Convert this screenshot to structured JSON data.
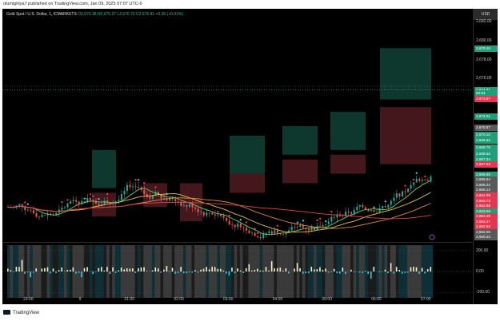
{
  "header": {
    "published_by": "olumightya7 published on TradingView.com, Jan 09, 2025 07:07 UTC-6"
  },
  "legend": {
    "symbol": "Gold Spot / U.S. Dollar, 1, ICMARKETS",
    "ohlc": "O2,676.18  H2,675.27  L2,676.73  C2,676.81  +0.36 (+0.01%)"
  },
  "axis": {
    "currency": "USD",
    "ticks": [
      {
        "label": "2,682.00",
        "v": 2682
      },
      {
        "label": "2,680.00",
        "v": 2680
      },
      {
        "label": "2,678.00",
        "v": 2678
      },
      {
        "label": "2,676.00",
        "v": 2676
      }
    ],
    "tags": [
      {
        "label": "2,679.10",
        "v": 2679.1,
        "color": "#1f9e7a"
      },
      {
        "label": "2,674.81",
        "v": 2674.81,
        "color": "#1f9e7a"
      },
      {
        "label": "00:53",
        "v": 2674.45,
        "color": "#1f9e7a"
      },
      {
        "label": "2,673.87",
        "v": 2673.87,
        "color": "#e2384f"
      },
      {
        "label": "2,672.01",
        "v": 2672.01,
        "color": "#1f9e7a"
      },
      {
        "label": "2,670.87",
        "v": 2670.87,
        "color": "#5a5a5a"
      },
      {
        "label": "2,670.10",
        "v": 2670.1,
        "color": "#1f9e7a"
      },
      {
        "label": "2,669.52",
        "v": 2669.52,
        "color": "#1f9e7a"
      },
      {
        "label": "2,668.76",
        "v": 2668.76,
        "color": "#1f9e7a"
      },
      {
        "label": "2,668.56",
        "v": 2668.1,
        "color": "#1f9e7a"
      },
      {
        "label": "2,667.34",
        "v": 2667.5,
        "color": "#1f9e7a"
      },
      {
        "label": "2,667.03",
        "v": 2666.95,
        "color": "#e2384f"
      },
      {
        "label": "2,665.85",
        "v": 2665.9,
        "color": "#1f9e7a"
      },
      {
        "label": "2,665.64",
        "v": 2665.35,
        "color": "#5a5a5a"
      },
      {
        "label": "2,665.22",
        "v": 2664.8,
        "color": "#5a5a5a"
      },
      {
        "label": "2,665.13",
        "v": 2664.25,
        "color": "#5a5a5a"
      },
      {
        "label": "2,664.99",
        "v": 2663.7,
        "color": "#e2384f"
      },
      {
        "label": "2,663.73",
        "v": 2663.15,
        "color": "#e2384f"
      },
      {
        "label": "2,663.68",
        "v": 2662.6,
        "color": "#e2384f"
      },
      {
        "label": "2,663.59",
        "v": 2662.05,
        "color": "#1f9e7a"
      },
      {
        "label": "2,663.49",
        "v": 2661.5,
        "color": "#e2384f"
      },
      {
        "label": "2,663.47",
        "v": 2660.95,
        "color": "#e2384f"
      },
      {
        "label": "2,662.94",
        "v": 2660.4,
        "color": "#e2384f"
      },
      {
        "label": "2,662.05",
        "v": 2659.85,
        "color": "#5a5a5a"
      },
      {
        "label": "2,660.43",
        "v": 2659.3,
        "color": "#5a5a5a"
      }
    ],
    "osc_ticks": [
      {
        "label": "200.00",
        "v": 200
      },
      {
        "label": "0.00",
        "v": 0
      },
      {
        "label": "-200.00",
        "v": -200
      }
    ]
  },
  "timeline": [
    {
      "label": "23:00",
      "f": 0.055
    },
    {
      "label": "9",
      "f": 0.165
    },
    {
      "label": "01:00",
      "f": 0.27
    },
    {
      "label": "02:00",
      "f": 0.375
    },
    {
      "label": "03:00",
      "f": 0.48
    },
    {
      "label": "04:00",
      "f": 0.585
    },
    {
      "label": "05:00",
      "f": 0.69
    },
    {
      "label": "06:00",
      "f": 0.795
    },
    {
      "label": "07:00",
      "f": 0.9
    }
  ],
  "footer": {
    "brand": "TradingView"
  },
  "colors": {
    "up": "#26a69a",
    "down": "#ef5350",
    "box_up": "#0f3d33",
    "box_down": "#4a1a1f",
    "ma_yellow": "#e6c34a",
    "ma_orange": "#e08a3c",
    "ma_red": "#e0424f",
    "ma_green": "#6bd36b"
  }
}
